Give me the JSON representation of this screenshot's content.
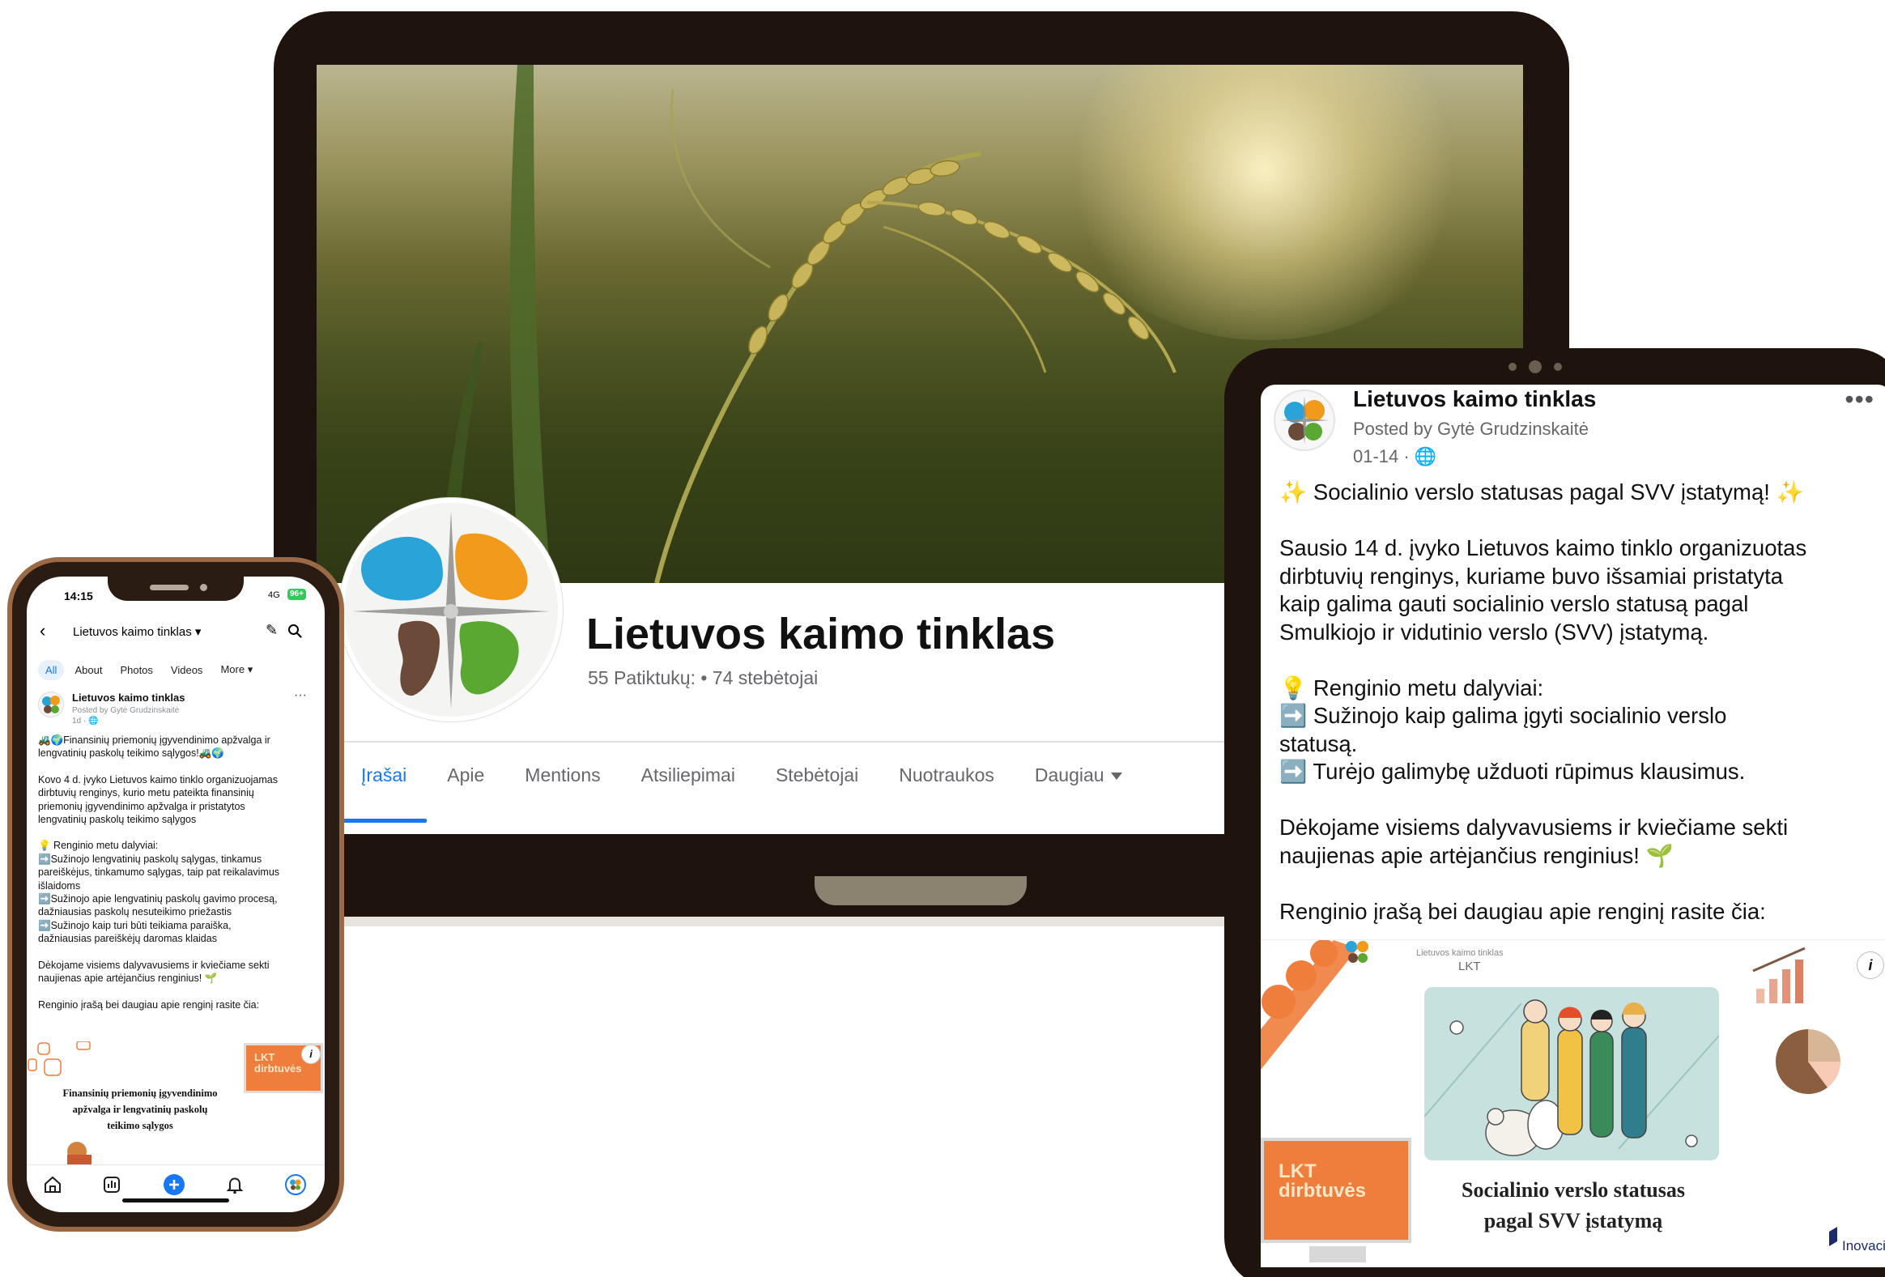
{
  "colors": {
    "device_frame": "#1e140d",
    "phone_frame": "#2a1c12",
    "facebook_blue": "#1877f2",
    "muted_text": "#65676b",
    "logo_blue": "#2aa4d8",
    "logo_orange": "#f29a1c",
    "logo_brown": "#6b4a3a",
    "logo_green": "#5aa832",
    "lkt_orange": "#ef7d3b"
  },
  "laptop": {
    "page_name": "Lietuvos kaimo tinklas",
    "stats": "55 Patiktukų: • 74 stebėtojai",
    "tabs": [
      {
        "label": "Įrašai",
        "active": true
      },
      {
        "label": "Apie"
      },
      {
        "label": "Mentions"
      },
      {
        "label": "Atsiliepimai"
      },
      {
        "label": "Stebėtojai"
      },
      {
        "label": "Nuotraukos"
      },
      {
        "label": "Daugiau",
        "dropdown": true
      }
    ]
  },
  "phone": {
    "status": {
      "time": "14:15",
      "network": "4G",
      "battery": "96+"
    },
    "header_title": "Lietuvos kaimo tinklas",
    "tabs": [
      {
        "label": "All",
        "active": true
      },
      {
        "label": "About"
      },
      {
        "label": "Photos"
      },
      {
        "label": "Videos"
      },
      {
        "label": "More"
      }
    ],
    "post": {
      "author": "Lietuvos kaimo tinklas",
      "posted_by": "Posted by Gytė Grudzinskaitė",
      "time": "1d ·",
      "lines": {
        "l1": "🚜🌍Finansinių priemonių įgyvendinimo apžvalga ir",
        "l2": "lengvatinių paskolų teikimo sąlygos!🚜🌍",
        "l3": "Kovo 4 d. įvyko Lietuvos kaimo tinklo organizuojamas",
        "l4": "dirbtuvių renginys, kurio metu pateikta finansinių",
        "l5": "priemonių įgyvendinimo apžvalga ir pristatytos",
        "l6": "lengvatinių paskolų teikimo sąlygos",
        "l7": "💡 Renginio metu dalyviai:",
        "l8": "➡️Sužinojo lengvatinių paskolų sąlygas, tinkamus",
        "l9": "pareiškėjus, tinkamumo sąlygas, taip pat reikalavimus",
        "l10": "išlaidoms",
        "l11": "➡️Sužinojo apie lengvatinių paskolų gavimo procesą,",
        "l12": "dažniausias paskolų nesuteikimo priežastis",
        "l13": "➡️Sužinojo kaip turi būti teikiama paraiška,",
        "l14": "dažniausias pareiškėjų daromas klaidas",
        "l15": "Dėkojame visiems dalyvavusiems ir kviečiame sekti",
        "l16": "naujienas apie artėjančius renginius! 🌱",
        "l17": "Renginio įrašą bei daugiau apie renginį rasite čia:"
      },
      "image": {
        "caption_l1": "Finansinių priemonių įgyvendinimo",
        "caption_l2": "apžvalga ir lengvatinių paskolų",
        "caption_l3": "teikimo sąlygos",
        "badge_l1": "LKT",
        "badge_l2": "dirbtuvės",
        "info": "i"
      }
    }
  },
  "tablet": {
    "author": "Lietuvos kaimo tinklas",
    "posted_by": "Posted by Gytė Grudzinskaitė",
    "time": "01-14 ·",
    "more": "•••",
    "lines": {
      "l1": "✨ Socialinio verslo statusas pagal SVV įstatymą! ✨",
      "l2": "Sausio 14 d. įvyko Lietuvos kaimo tinklo organizuotas",
      "l3": "dirbtuvių renginys, kuriame buvo išsamiai pristatyta",
      "l4": "kaip galima gauti socialinio verslo statusą pagal",
      "l5": "Smulkiojo ir vidutinio verslo (SVV) įstatymą.",
      "l6": "💡 Renginio metu dalyviai:",
      "l7": "➡️ Sužinojo kaip galima įgyti socialinio verslo",
      "l8": "statusą.",
      "l9": "➡️ Turėjo galimybę užduoti rūpimus klausimus.",
      "l10": "Dėkojame visiems dalyvavusiems ir kviečiame sekti",
      "l11": "naujienas apie artėjančius renginius! 🌱",
      "l12": "Renginio įrašą bei daugiau apie renginį rasite čia:"
    },
    "image": {
      "logo_text": "Lietuvos kaimo tinklas",
      "logo_sub": "LKT",
      "caption_l1": "Socialinio verslo statusas",
      "caption_l2": "pagal SVV įstatymą",
      "badge_l1": "LKT",
      "badge_l2": "dirbtuvės",
      "partner": "Inovacijų",
      "info": "i"
    }
  }
}
